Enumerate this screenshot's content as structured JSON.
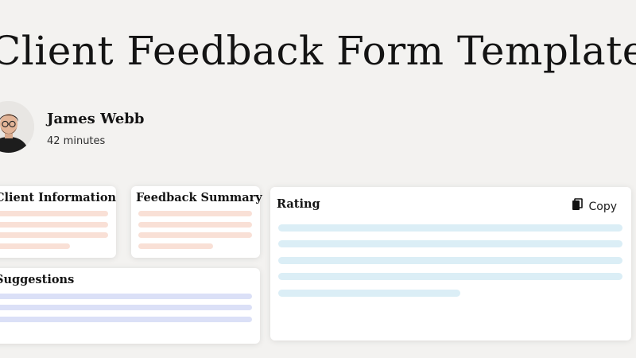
{
  "page": {
    "title": "Client Feedback Form Template"
  },
  "author": {
    "name": "James Webb",
    "meta": "42 minutes"
  },
  "cards": {
    "client_info": {
      "title": "Client Information"
    },
    "feedback_summary": {
      "title": "Feedback Summary"
    },
    "suggestions": {
      "title": "Suggestions"
    },
    "rating": {
      "title": "Rating",
      "copy_label": "Copy"
    }
  },
  "icons": {
    "copy": "copy-icon",
    "avatar": "avatar"
  },
  "colors": {
    "background": "#f3f2f0",
    "placeholder_pink": "#f9e0d6",
    "placeholder_lavender": "#dbe0f7",
    "placeholder_sky": "#dbeef6"
  }
}
